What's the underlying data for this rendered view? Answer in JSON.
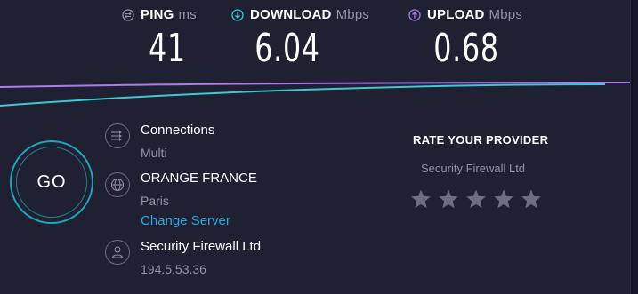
{
  "metrics": {
    "ping": {
      "label": "PING",
      "unit": "ms",
      "value": "41",
      "icon": "ping-icon",
      "color": "#9193a8"
    },
    "download": {
      "label": "DOWNLOAD",
      "unit": "Mbps",
      "value": "6.04",
      "icon": "download-arrow-icon",
      "color": "#3ec8d4"
    },
    "upload": {
      "label": "UPLOAD",
      "unit": "Mbps",
      "value": "0.68",
      "icon": "upload-arrow-icon",
      "color": "#a57fe6"
    }
  },
  "colors": {
    "background": "#1f2032",
    "accent_cyan": "#3ec8d4",
    "accent_purple": "#a57fe6",
    "link": "#2fa8e0",
    "muted": "#9193a8"
  },
  "go_button": {
    "label": "GO"
  },
  "connections": {
    "title": "Connections",
    "value": "Multi",
    "icon": "connections-icon"
  },
  "server": {
    "title": "ORANGE FRANCE",
    "location": "Paris",
    "change_label": "Change Server",
    "icon": "globe-icon"
  },
  "provider": {
    "title": "Security Firewall Ltd",
    "ip": "194.5.53.36",
    "icon": "user-icon"
  },
  "rating": {
    "title": "RATE YOUR PROVIDER",
    "provider_name": "Security Firewall Ltd",
    "stars_total": 5,
    "stars_selected": 0
  }
}
